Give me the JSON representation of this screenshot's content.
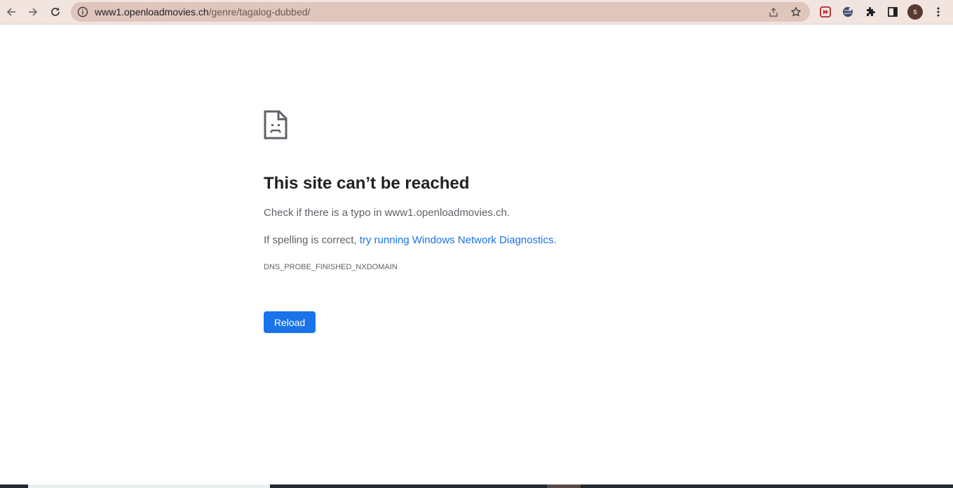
{
  "browser": {
    "url_host": "www1.openloadmovies.ch",
    "url_path": "/genre/tagalog-dubbed/",
    "profile_initial": "s",
    "icons": {
      "back": "back-arrow-icon",
      "forward": "forward-arrow-icon",
      "reload": "reload-icon",
      "site_info": "info-icon",
      "share": "share-icon",
      "bookmark": "star-icon",
      "extension_1": "media-extension-icon",
      "extension_2": "globe-extension-icon",
      "extensions": "puzzle-icon",
      "side_panel": "side-panel-icon",
      "menu": "kebab-menu-icon"
    },
    "colors": {
      "toolbar": "#f2e4df",
      "omnibox": "#dfc6bd",
      "accent": "#1a73e8"
    }
  },
  "error_page": {
    "icon": "sad-page-icon",
    "title": "This site can’t be reached",
    "typo_hint": "Check if there is a typo in www1.openloadmovies.ch.",
    "spelling_prefix": "If spelling is correct, ",
    "diagnostics_link": "try running Windows Network Diagnostics",
    "spelling_suffix": ".",
    "error_code": "DNS_PROBE_FINISHED_NXDOMAIN",
    "reload_label": "Reload"
  }
}
